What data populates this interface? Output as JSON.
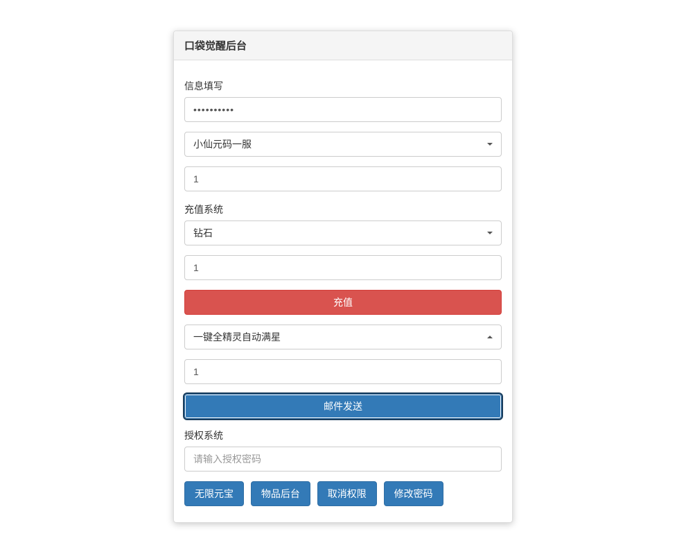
{
  "panel": {
    "title": "口袋觉醒后台"
  },
  "info": {
    "label": "信息填写",
    "password_value": "••••••••••",
    "server_selected": "小仙元码一服",
    "quantity1_value": "1"
  },
  "recharge": {
    "label": "充值系统",
    "type_selected": "钻石",
    "amount_value": "1",
    "button_label": "充值"
  },
  "mail": {
    "action_selected": "一键全精灵自动满星",
    "amount_value": "1",
    "send_button_label": "邮件发送"
  },
  "auth": {
    "label": "授权系统",
    "password_placeholder": "请输入授权密码"
  },
  "actions": {
    "unlimited_yuanbao": "无限元宝",
    "item_backend": "物品后台",
    "revoke_permission": "取消权限",
    "change_password": "修改密码"
  }
}
